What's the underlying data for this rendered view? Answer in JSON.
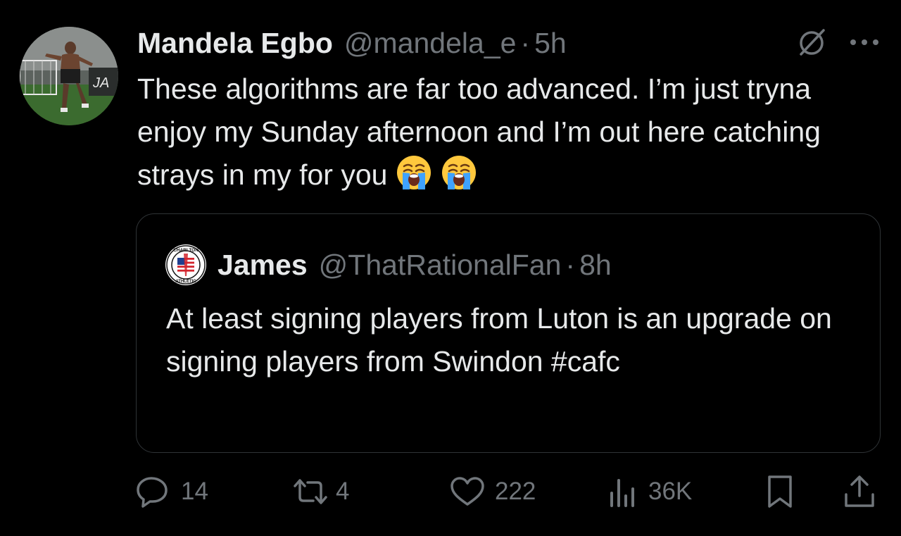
{
  "tweet": {
    "author_name": "Mandela Egbo",
    "author_handle": "@mandela_e",
    "separator": "·",
    "time": "5h",
    "text": "These algorithms are far too advanced. I’m just tryna enjoy my Sunday afternoon and I’m out here catching strays in my for you",
    "emojis": [
      "loudly-crying-face",
      "loudly-crying-face"
    ],
    "avatar_logo_text": "JA"
  },
  "quoted_tweet": {
    "author_name": "James",
    "author_handle": "@ThatRationalFan",
    "separator": "·",
    "time": "8h",
    "text": "At least signing players from Luton is an upgrade on signing players from Swindon #cafc",
    "avatar_badge_text_top": "CHARLTON",
    "avatar_badge_text_bottom": "ATHLETIC"
  },
  "header_icons": [
    "mute-slash-icon",
    "more-icon"
  ],
  "actions": {
    "replies": "14",
    "retweets": "4",
    "likes": "222",
    "views": "36K"
  },
  "colors": {
    "background": "#000000",
    "text_primary": "#e7e9ea",
    "text_muted": "#71767b",
    "border": "#2f3336"
  }
}
